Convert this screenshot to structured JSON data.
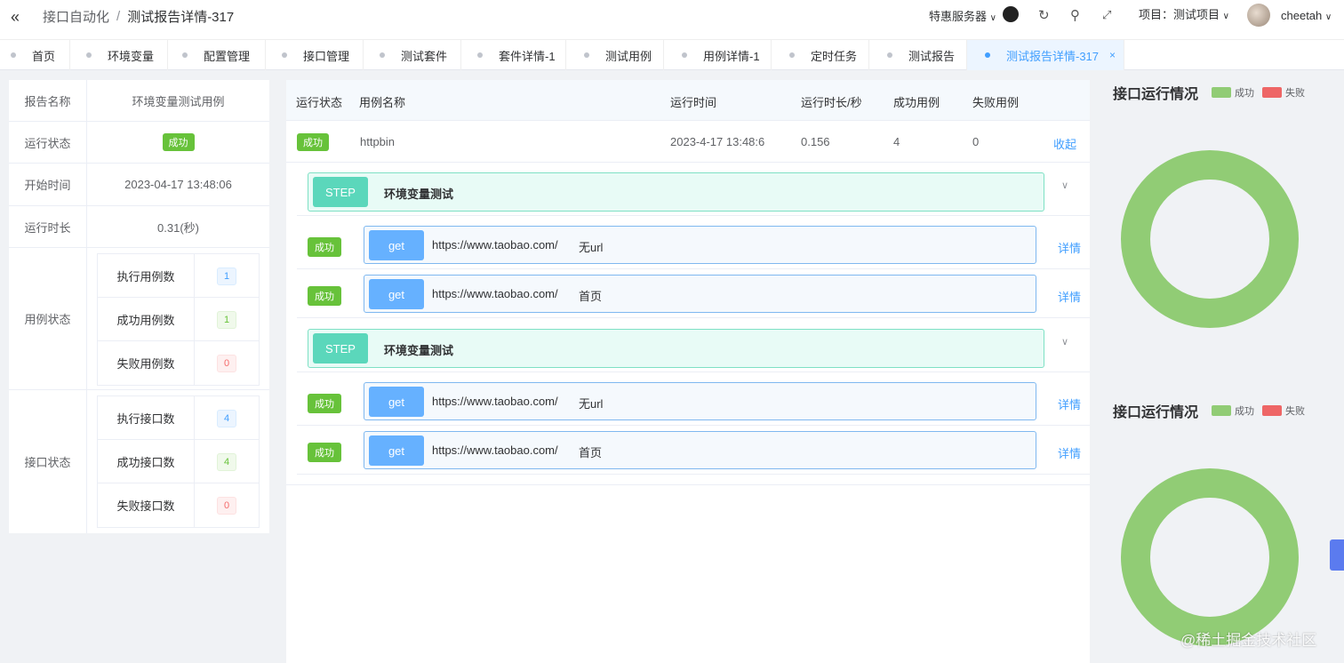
{
  "header": {
    "breadcrumb": [
      "接口自动化",
      "测试报告详情-317"
    ],
    "separator": "/",
    "collapse_icon": "«",
    "service_label": "特惠服务器",
    "project_label": "项目：测试项目",
    "username": "cheetah"
  },
  "tabs": [
    {
      "label": "首页"
    },
    {
      "label": "环境变量"
    },
    {
      "label": "配置管理"
    },
    {
      "label": "接口管理"
    },
    {
      "label": "测试套件"
    },
    {
      "label": "套件详情-1"
    },
    {
      "label": "测试用例"
    },
    {
      "label": "用例详情-1"
    },
    {
      "label": "定时任务"
    },
    {
      "label": "测试报告"
    },
    {
      "label": "测试报告详情-317",
      "active": true,
      "close": "×"
    }
  ],
  "summary": {
    "report_name_key": "报告名称",
    "report_name": "环境变量测试用例",
    "run_status_key": "运行状态",
    "run_status": "成功",
    "start_time_key": "开始时间",
    "start_time": "2023-04-17 13:48:06",
    "duration_key": "运行时长",
    "duration": "0.31(秒)",
    "case_status_key": "用例状态",
    "case_stats": [
      {
        "label": "执行用例数",
        "value": "1",
        "color": "blue"
      },
      {
        "label": "成功用例数",
        "value": "1",
        "color": "green"
      },
      {
        "label": "失败用例数",
        "value": "0",
        "color": "red"
      }
    ],
    "api_status_key": "接口状态",
    "api_stats": [
      {
        "label": "执行接口数",
        "value": "4",
        "color": "blue"
      },
      {
        "label": "成功接口数",
        "value": "4",
        "color": "green"
      },
      {
        "label": "失败接口数",
        "value": "0",
        "color": "red"
      }
    ]
  },
  "table": {
    "headers": [
      "运行状态",
      "用例名称",
      "运行时间",
      "运行时长/秒",
      "成功用例",
      "失败用例"
    ],
    "row": {
      "status": "成功",
      "name": "httpbin",
      "time": "2023-4-17 13:48:6",
      "duration": "0.156",
      "success": "4",
      "fail": "0",
      "action": "收起"
    },
    "steps": [
      {
        "tag": "STEP",
        "name": "环境变量测试",
        "apis": [
          {
            "status": "成功",
            "method": "get",
            "url": "https://www.taobao.com/",
            "name": "无url",
            "action": "详情"
          },
          {
            "status": "成功",
            "method": "get",
            "url": "https://www.taobao.com/",
            "name": "首页",
            "action": "详情"
          }
        ]
      },
      {
        "tag": "STEP",
        "name": "环境变量测试",
        "apis": [
          {
            "status": "成功",
            "method": "get",
            "url": "https://www.taobao.com/",
            "name": "无url",
            "action": "详情"
          },
          {
            "status": "成功",
            "method": "get",
            "url": "https://www.taobao.com/",
            "name": "首页",
            "action": "详情"
          }
        ]
      }
    ]
  },
  "charts_panel": [
    {
      "title": "接口运行情况",
      "legend": [
        {
          "label": "成功",
          "color": "#91cc75"
        },
        {
          "label": "失败",
          "color": "#ee6666"
        }
      ]
    },
    {
      "title": "接口运行情况",
      "legend": [
        {
          "label": "成功",
          "color": "#91cc75"
        },
        {
          "label": "失败",
          "color": "#ee6666"
        }
      ]
    }
  ],
  "chart_data": [
    {
      "type": "pie",
      "title": "接口运行情况",
      "categories": [
        "成功",
        "失败"
      ],
      "values": [
        4,
        0
      ],
      "donut": true,
      "legend": "top-right"
    },
    {
      "type": "pie",
      "title": "接口运行情况",
      "categories": [
        "成功",
        "失败"
      ],
      "values": [
        4,
        0
      ],
      "donut": true,
      "legend": "top-right"
    }
  ],
  "watermark": "@稀土掘金技术社区"
}
